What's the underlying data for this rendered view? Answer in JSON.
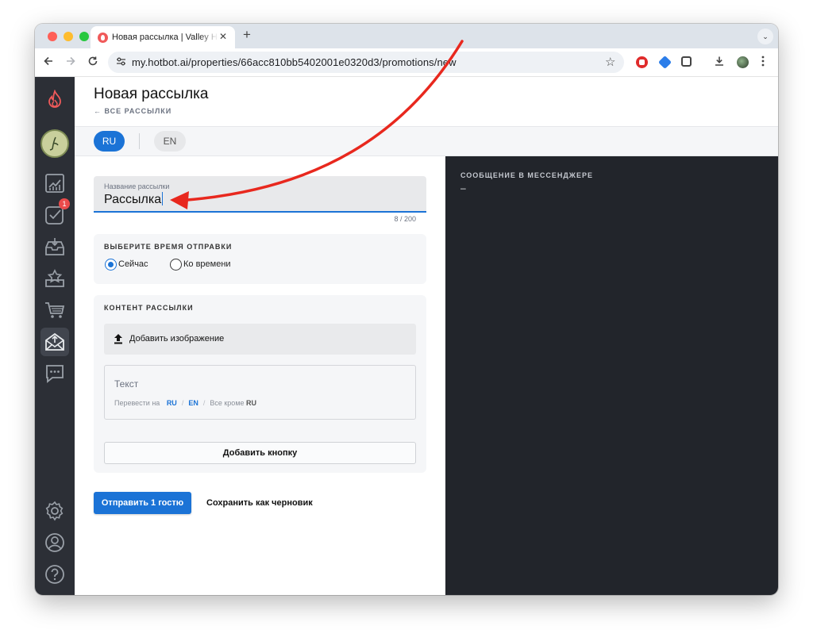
{
  "browser": {
    "tab_title": "Новая рассылка | Valley Hotel",
    "tab_close": "✕",
    "new_tab": "+",
    "tab_search": "⌄",
    "url": "my.hotbot.ai/properties/66acc810bb5402001e0320d3/promotions/new",
    "icons": [
      "back-icon",
      "forward-icon",
      "reload-icon",
      "tune-icon",
      "star-icon",
      "download-icon",
      "menu-icon"
    ]
  },
  "sidebar": {
    "badge_count": "1",
    "items": [
      "analytics-icon",
      "tasks-icon",
      "inbox-icon",
      "reviews-icon",
      "shop-icon",
      "promotions-icon",
      "chat-icon",
      "settings-icon",
      "profile-icon",
      "help-icon"
    ]
  },
  "header": {
    "title": "Новая рассылка",
    "back_link": "← ВСЕ РАССЫЛКИ"
  },
  "languages": {
    "ru": "RU",
    "en": "EN"
  },
  "form": {
    "name_label": "Название рассылки",
    "name_value": "Рассылка",
    "counter": "8 / 200",
    "time_title": "ВЫБЕРИТЕ ВРЕМЯ ОТПРАВКИ",
    "time_now": "Сейчас",
    "time_scheduled": "Ко времени",
    "content_title": "КОНТЕНТ РАССЫЛКИ",
    "add_image": "Добавить изображение",
    "text_placeholder": "Текст",
    "translate_to": "Перевести на",
    "translate_ru": "RU",
    "translate_en": "EN",
    "translate_except": "Все кроме",
    "translate_except_lang": "RU",
    "add_button": "Добавить кнопку",
    "send_button": "Отправить 1 гостю",
    "draft_button": "Сохранить как черновик"
  },
  "preview": {
    "title": "СООБЩЕНИЕ В МЕССЕНДЖЕРЕ",
    "body": "–"
  },
  "colors": {
    "accent": "#1b73d6",
    "sidebar": "#2c2f36",
    "preview": "#22252b",
    "annotation": "#e8281e"
  }
}
